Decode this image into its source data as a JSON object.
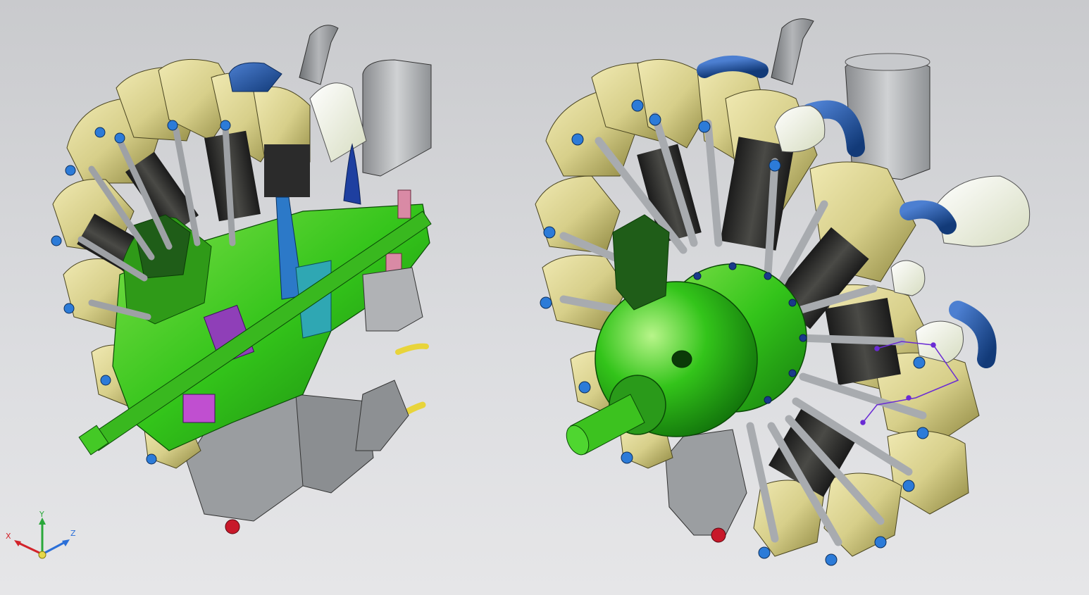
{
  "viewport": {
    "background_top": "#c9cacd",
    "background_bottom": "#e6e6e8"
  },
  "colors": {
    "crankcase_green": "#33c41a",
    "crankcase_green_light": "#7fe04a",
    "crankcase_green_dark": "#0f7a0a",
    "cylinder_brass": "#d7cf8a",
    "cylinder_brass_dark": "#8e8740",
    "pushrod_gray": "#b9bcc0",
    "exhaust_gray": "#8f9295",
    "manifold_blue": "#1e4f9c",
    "carburetor_gray": "#a7a9ac",
    "cutaway_purple": "#8f3fb8",
    "cutaway_cyan": "#2fa7b3",
    "cutaway_pink": "#d98aa5",
    "yellow_pipe": "#e8d43a",
    "red_part": "#c8182a",
    "sketch_purple": "#6a2bd4"
  },
  "models": [
    {
      "id": "cutaway-view",
      "label": ""
    },
    {
      "id": "assembled-view",
      "label": ""
    }
  ],
  "triad": {
    "x_label": "X",
    "y_label": "Y",
    "z_label": "Z",
    "x_color": "#d2232a",
    "y_color": "#2aa83a",
    "z_color": "#2b6fd8",
    "origin_color": "#e6d84a"
  }
}
